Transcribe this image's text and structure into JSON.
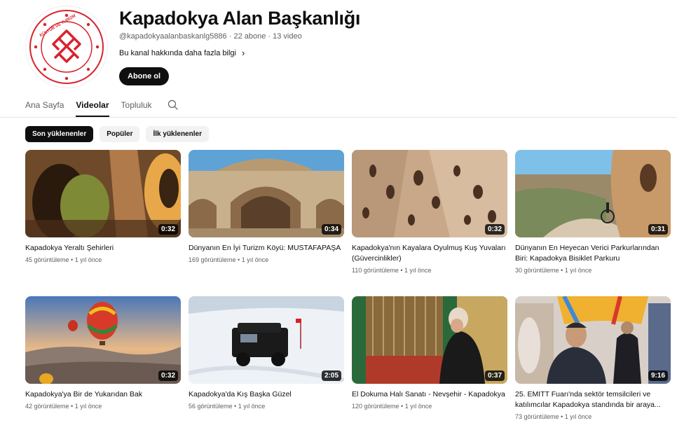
{
  "channel": {
    "title": "Kapadokya Alan Başkanlığı",
    "meta": "@kapadokyaalanbaskanlg5886 · 22 abone · 13 video",
    "about": "Bu kanal hakkında daha fazla bilgi",
    "subscribe_label": "Abone ol",
    "logo_text": "TÜRKİYE CUMHURİYETİ KÜLTÜR VE TURİZM BAKANLIĞI",
    "brand_red": "#d9232d"
  },
  "tabs": [
    {
      "label": "Ana Sayfa"
    },
    {
      "label": "Videolar"
    },
    {
      "label": "Topluluk"
    }
  ],
  "chips": [
    {
      "label": "Son yüklenenler"
    },
    {
      "label": "Popüler"
    },
    {
      "label": "İlk yüklenenler"
    }
  ],
  "videos": [
    {
      "title": "Kapadokya Yeraltı Şehirleri",
      "meta": "45 görüntüleme • 1 yıl önce",
      "duration": "0:32"
    },
    {
      "title": "Dünyanın En İyi Turizm Köyü: MUSTAFAPAŞA",
      "meta": "169 görüntüleme • 1 yıl önce",
      "duration": "0:34"
    },
    {
      "title": "Kapadokya'nın Kayalara Oyulmuş Kuş Yuvaları (Güvercinlikler)",
      "meta": "110 görüntüleme • 1 yıl önce",
      "duration": "0:32"
    },
    {
      "title": "Dünyanın En Heyecan Verici Parkurlarından Biri: Kapadokya Bisiklet Parkuru",
      "meta": "30 görüntüleme • 1 yıl önce",
      "duration": "0:31"
    },
    {
      "title": "Kapadokya'ya Bir de Yukarıdan Bak",
      "meta": "42 görüntüleme • 1 yıl önce",
      "duration": "0:32"
    },
    {
      "title": "Kapadokya'da Kış Başka Güzel",
      "meta": "56 görüntüleme • 1 yıl önce",
      "duration": "2:05"
    },
    {
      "title": "El Dokuma Halı Sanatı - Nevşehir - Kapadokya",
      "meta": "120 görüntüleme • 1 yıl önce",
      "duration": "0:37"
    },
    {
      "title": "25. EMITT Fuarı'nda sektör temsilcileri ve katılımcılar Kapadokya standında bir araya...",
      "meta": "73 görüntüleme • 1 yıl önce",
      "duration": "9:16"
    }
  ]
}
